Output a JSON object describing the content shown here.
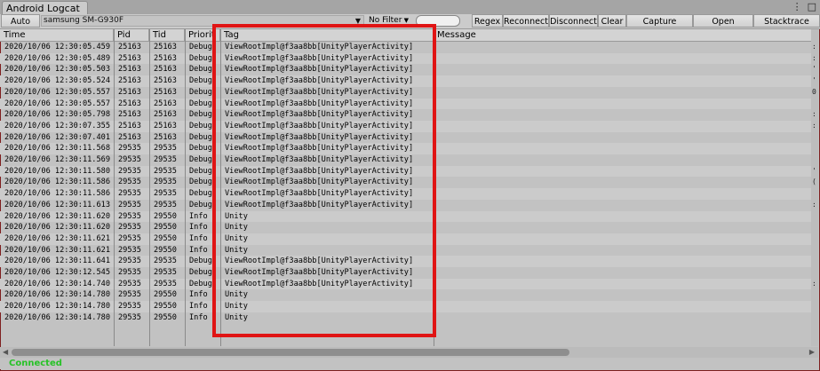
{
  "window": {
    "title": "Android Logcat"
  },
  "toolbar": {
    "auto_run": "Auto Run",
    "device": "samsung SM-G930F",
    "filter": "No Filter",
    "regex": "Regex",
    "reconnect": "Reconnect",
    "disconnect": "Disconnect",
    "clear": "Clear",
    "capture_screen": "Capture Screen",
    "open_terminal": "Open Terminal",
    "stacktrace_utility": "Stacktrace Utility"
  },
  "columns": {
    "time": "Time",
    "pid": "Pid",
    "tid": "Tid",
    "priority": "Priorit",
    "tag": "Tag",
    "message": "Message"
  },
  "rows": [
    {
      "time": "2020/10/06 12:30:05.459",
      "pid": "25163",
      "tid": "25163",
      "priority": "Debug",
      "tag": "ViewRootImpl@f3aa8bb[UnityPlayerActivity]"
    },
    {
      "time": "2020/10/06 12:30:05.489",
      "pid": "25163",
      "tid": "25163",
      "priority": "Debug",
      "tag": "ViewRootImpl@f3aa8bb[UnityPlayerActivity]"
    },
    {
      "time": "2020/10/06 12:30:05.503",
      "pid": "25163",
      "tid": "25163",
      "priority": "Debug",
      "tag": "ViewRootImpl@f3aa8bb[UnityPlayerActivity]"
    },
    {
      "time": "2020/10/06 12:30:05.524",
      "pid": "25163",
      "tid": "25163",
      "priority": "Debug",
      "tag": "ViewRootImpl@f3aa8bb[UnityPlayerActivity]"
    },
    {
      "time": "2020/10/06 12:30:05.557",
      "pid": "25163",
      "tid": "25163",
      "priority": "Debug",
      "tag": "ViewRootImpl@f3aa8bb[UnityPlayerActivity]"
    },
    {
      "time": "2020/10/06 12:30:05.557",
      "pid": "25163",
      "tid": "25163",
      "priority": "Debug",
      "tag": "ViewRootImpl@f3aa8bb[UnityPlayerActivity]"
    },
    {
      "time": "2020/10/06 12:30:05.798",
      "pid": "25163",
      "tid": "25163",
      "priority": "Debug",
      "tag": "ViewRootImpl@f3aa8bb[UnityPlayerActivity]"
    },
    {
      "time": "2020/10/06 12:30:07.355",
      "pid": "25163",
      "tid": "25163",
      "priority": "Debug",
      "tag": "ViewRootImpl@f3aa8bb[UnityPlayerActivity]"
    },
    {
      "time": "2020/10/06 12:30:07.401",
      "pid": "25163",
      "tid": "25163",
      "priority": "Debug",
      "tag": "ViewRootImpl@f3aa8bb[UnityPlayerActivity]"
    },
    {
      "time": "2020/10/06 12:30:11.568",
      "pid": "29535",
      "tid": "29535",
      "priority": "Debug",
      "tag": "ViewRootImpl@f3aa8bb[UnityPlayerActivity]"
    },
    {
      "time": "2020/10/06 12:30:11.569",
      "pid": "29535",
      "tid": "29535",
      "priority": "Debug",
      "tag": "ViewRootImpl@f3aa8bb[UnityPlayerActivity]"
    },
    {
      "time": "2020/10/06 12:30:11.580",
      "pid": "29535",
      "tid": "29535",
      "priority": "Debug",
      "tag": "ViewRootImpl@f3aa8bb[UnityPlayerActivity]"
    },
    {
      "time": "2020/10/06 12:30:11.586",
      "pid": "29535",
      "tid": "29535",
      "priority": "Debug",
      "tag": "ViewRootImpl@f3aa8bb[UnityPlayerActivity]"
    },
    {
      "time": "2020/10/06 12:30:11.586",
      "pid": "29535",
      "tid": "29535",
      "priority": "Debug",
      "tag": "ViewRootImpl@f3aa8bb[UnityPlayerActivity]"
    },
    {
      "time": "2020/10/06 12:30:11.613",
      "pid": "29535",
      "tid": "29535",
      "priority": "Debug",
      "tag": "ViewRootImpl@f3aa8bb[UnityPlayerActivity]"
    },
    {
      "time": "2020/10/06 12:30:11.620",
      "pid": "29535",
      "tid": "29550",
      "priority": "Info",
      "tag": "Unity"
    },
    {
      "time": "2020/10/06 12:30:11.620",
      "pid": "29535",
      "tid": "29550",
      "priority": "Info",
      "tag": "Unity"
    },
    {
      "time": "2020/10/06 12:30:11.621",
      "pid": "29535",
      "tid": "29550",
      "priority": "Info",
      "tag": "Unity"
    },
    {
      "time": "2020/10/06 12:30:11.621",
      "pid": "29535",
      "tid": "29550",
      "priority": "Info",
      "tag": "Unity"
    },
    {
      "time": "2020/10/06 12:30:11.641",
      "pid": "29535",
      "tid": "29535",
      "priority": "Debug",
      "tag": "ViewRootImpl@f3aa8bb[UnityPlayerActivity]"
    },
    {
      "time": "2020/10/06 12:30:12.545",
      "pid": "29535",
      "tid": "29535",
      "priority": "Debug",
      "tag": "ViewRootImpl@f3aa8bb[UnityPlayerActivity]"
    },
    {
      "time": "2020/10/06 12:30:14.740",
      "pid": "29535",
      "tid": "29535",
      "priority": "Debug",
      "tag": "ViewRootImpl@f3aa8bb[UnityPlayerActivity]"
    },
    {
      "time": "2020/10/06 12:30:14.780",
      "pid": "29535",
      "tid": "29550",
      "priority": "Info",
      "tag": "Unity"
    },
    {
      "time": "2020/10/06 12:30:14.780",
      "pid": "29535",
      "tid": "29550",
      "priority": "Info",
      "tag": "Unity"
    },
    {
      "time": "2020/10/06 12:30:14.780",
      "pid": "29535",
      "tid": "29550",
      "priority": "Info",
      "tag": "Unity"
    }
  ],
  "message_edge": [
    ":",
    ":",
    "'",
    "'",
    "0",
    "",
    ":",
    ":",
    "",
    "",
    "",
    "'",
    "(",
    "",
    ":",
    "",
    "",
    "",
    "",
    "",
    "",
    ":",
    "",
    "",
    ""
  ],
  "status": {
    "text": "Connected",
    "color": "#27c227"
  },
  "colors": {
    "highlight": "#e01414",
    "row_alt": "#cbcbcb",
    "background": "#c2c2c2"
  },
  "icons": {
    "window_menu": "kebab-menu-icon",
    "window_max": "maximize-icon",
    "filter_dropdown": "chevron-down-icon"
  }
}
